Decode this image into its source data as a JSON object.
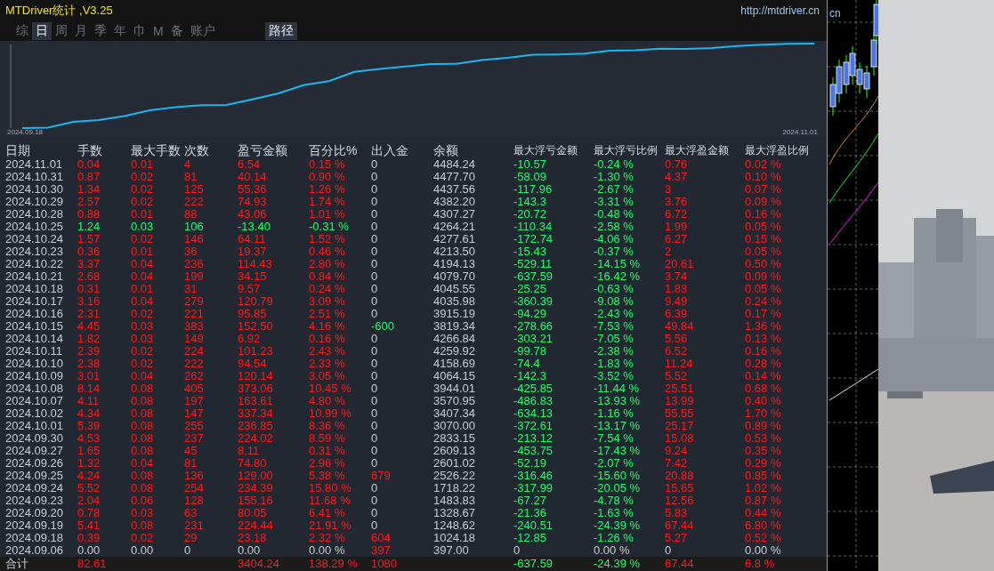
{
  "window": {
    "title": "MTDriver统计 ,V3.25",
    "url": "http://mtdriver.cn"
  },
  "tabs": [
    {
      "label": "综",
      "selected": false
    },
    {
      "label": "日",
      "selected": true
    },
    {
      "label": "周",
      "selected": false
    },
    {
      "label": "月",
      "selected": false
    },
    {
      "label": "季",
      "selected": false
    },
    {
      "label": "年",
      "selected": false
    },
    {
      "label": "巾",
      "selected": false
    },
    {
      "label": "M",
      "selected": false
    },
    {
      "label": "备",
      "selected": false
    },
    {
      "label": "账户",
      "selected": false
    }
  ],
  "path_button": "路径",
  "chart": {
    "start_label": "2024.09.18",
    "end_label": "2024.11.01"
  },
  "table": {
    "columns": [
      "日期",
      "手数",
      "最大手数",
      "次数",
      "盈亏金额",
      "百分比%",
      "出入金",
      "余额",
      "最大浮亏金额",
      "最大浮亏比例",
      "最大浮盈金额",
      "最大浮盈比例"
    ],
    "rows": [
      {
        "cells": [
          "2024.11.01",
          "0.04",
          "0.01",
          "4",
          "6.54",
          "0.15 %",
          "0",
          "4484.24",
          "-10.57",
          "-0.24 %",
          "0.76",
          "0.02 %"
        ],
        "kind": "profit",
        "deposit": false,
        "withdrawal": false
      },
      {
        "cells": [
          "2024.10.31",
          "0.87",
          "0.02",
          "81",
          "40.14",
          "0.90 %",
          "0",
          "4477.70",
          "-58.09",
          "-1.30 %",
          "4.37",
          "0.10 %"
        ],
        "kind": "profit",
        "deposit": false,
        "withdrawal": false
      },
      {
        "cells": [
          "2024.10.30",
          "1.34",
          "0.02",
          "125",
          "55.36",
          "1.26 %",
          "0",
          "4437.56",
          "-117.96",
          "-2.67 %",
          "3",
          "0.07 %"
        ],
        "kind": "profit",
        "deposit": false,
        "withdrawal": false
      },
      {
        "cells": [
          "2024.10.29",
          "2.57",
          "0.02",
          "222",
          "74.93",
          "1.74 %",
          "0",
          "4382.20",
          "-143.3",
          "-3.31 %",
          "3.76",
          "0.09 %"
        ],
        "kind": "profit",
        "deposit": false,
        "withdrawal": false
      },
      {
        "cells": [
          "2024.10.28",
          "0.88",
          "0.01",
          "88",
          "43.06",
          "1.01 %",
          "0",
          "4307.27",
          "-20.72",
          "-0.48 %",
          "6.72",
          "0.16 %"
        ],
        "kind": "profit",
        "deposit": false,
        "withdrawal": false
      },
      {
        "cells": [
          "2024.10.25",
          "1.24",
          "0.03",
          "106",
          "-13.40",
          "-0.31 %",
          "0",
          "4264.21",
          "-110.34",
          "-2.58 %",
          "1.99",
          "0.05 %"
        ],
        "kind": "loss",
        "deposit": false,
        "withdrawal": false
      },
      {
        "cells": [
          "2024.10.24",
          "1.57",
          "0.02",
          "146",
          "64.11",
          "1.52 %",
          "0",
          "4277.61",
          "-172.74",
          "-4.06 %",
          "6.27",
          "0.15 %"
        ],
        "kind": "profit",
        "deposit": false,
        "withdrawal": false
      },
      {
        "cells": [
          "2024.10.23",
          "0.36",
          "0.01",
          "36",
          "19.37",
          "0.46 %",
          "0",
          "4213.50",
          "-15.43",
          "-0.37 %",
          "2",
          "0.05 %"
        ],
        "kind": "profit",
        "deposit": false,
        "withdrawal": false
      },
      {
        "cells": [
          "2024.10.22",
          "3.37",
          "0.04",
          "236",
          "114.43",
          "2.80 %",
          "0",
          "4194.13",
          "-529.11",
          "-14.15 %",
          "20.61",
          "0.50 %"
        ],
        "kind": "profit",
        "deposit": false,
        "withdrawal": false
      },
      {
        "cells": [
          "2024.10.21",
          "2.68",
          "0.04",
          "199",
          "34.15",
          "0.84 %",
          "0",
          "4079.70",
          "-637.59",
          "-16.42 %",
          "3.74",
          "0.09 %"
        ],
        "kind": "profit",
        "deposit": false,
        "withdrawal": false
      },
      {
        "cells": [
          "2024.10.18",
          "0.31",
          "0.01",
          "31",
          "9.57",
          "0.24 %",
          "0",
          "4045.55",
          "-25.25",
          "-0.63 %",
          "1.83",
          "0.05 %"
        ],
        "kind": "profit",
        "deposit": false,
        "withdrawal": false
      },
      {
        "cells": [
          "2024.10.17",
          "3.16",
          "0.04",
          "279",
          "120.79",
          "3.09 %",
          "0",
          "4035.98",
          "-360.39",
          "-9.08 %",
          "9.49",
          "0.24 %"
        ],
        "kind": "profit",
        "deposit": false,
        "withdrawal": false
      },
      {
        "cells": [
          "2024.10.16",
          "2.31",
          "0.02",
          "221",
          "95.85",
          "2.51 %",
          "0",
          "3915.19",
          "-94.29",
          "-2.43 %",
          "6.39",
          "0.17 %"
        ],
        "kind": "profit",
        "deposit": false,
        "withdrawal": false
      },
      {
        "cells": [
          "2024.10.15",
          "4.45",
          "0.03",
          "383",
          "152.50",
          "4.16 %",
          "-600",
          "3819.34",
          "-278.66",
          "-7.53 %",
          "49.84",
          "1.36 %"
        ],
        "kind": "profit",
        "deposit": false,
        "withdrawal": true
      },
      {
        "cells": [
          "2024.10.14",
          "1.82",
          "0.03",
          "149",
          "6.92",
          "0.16 %",
          "0",
          "4266.84",
          "-303.21",
          "-7.05 %",
          "5.56",
          "0.13 %"
        ],
        "kind": "profit",
        "deposit": false,
        "withdrawal": false
      },
      {
        "cells": [
          "2024.10.11",
          "2.39",
          "0.02",
          "224",
          "101.23",
          "2.43 %",
          "0",
          "4259.92",
          "-99.78",
          "-2.38 %",
          "6.52",
          "0.16 %"
        ],
        "kind": "profit",
        "deposit": false,
        "withdrawal": false
      },
      {
        "cells": [
          "2024.10.10",
          "2.38",
          "0.02",
          "222",
          "94.54",
          "2.33 %",
          "0",
          "4158.69",
          "-74.4",
          "-1.83 %",
          "11.24",
          "0.28 %"
        ],
        "kind": "profit",
        "deposit": false,
        "withdrawal": false
      },
      {
        "cells": [
          "2024.10.09",
          "3.01",
          "0.04",
          "262",
          "120.14",
          "3.05 %",
          "0",
          "4064.15",
          "-142.3",
          "-3.52 %",
          "5.52",
          "0.14 %"
        ],
        "kind": "profit",
        "deposit": false,
        "withdrawal": false
      },
      {
        "cells": [
          "2024.10.08",
          "8.14",
          "0.08",
          "405",
          "373.06",
          "10.45 %",
          "0",
          "3944.01",
          "-425.85",
          "-11.44 %",
          "25.51",
          "0.68 %"
        ],
        "kind": "profit",
        "deposit": false,
        "withdrawal": false
      },
      {
        "cells": [
          "2024.10.07",
          "4.11",
          "0.08",
          "197",
          "163.61",
          "4.80 %",
          "0",
          "3570.95",
          "-486.83",
          "-13.93 %",
          "13.99",
          "0.40 %"
        ],
        "kind": "profit",
        "deposit": false,
        "withdrawal": false
      },
      {
        "cells": [
          "2024.10.02",
          "4.34",
          "0.08",
          "147",
          "337.34",
          "10.99 %",
          "0",
          "3407.34",
          "-634.13",
          "-1.16 %",
          "55.55",
          "1.70 %"
        ],
        "kind": "profit",
        "deposit": false,
        "withdrawal": false
      },
      {
        "cells": [
          "2024.10.01",
          "5.39",
          "0.08",
          "255",
          "236.85",
          "8.36 %",
          "0",
          "3070.00",
          "-372.61",
          "-13.17 %",
          "25.17",
          "0.89 %"
        ],
        "kind": "profit",
        "deposit": false,
        "withdrawal": false
      },
      {
        "cells": [
          "2024.09.30",
          "4.53",
          "0.08",
          "237",
          "224.02",
          "8.59 %",
          "0",
          "2833.15",
          "-213.12",
          "-7.54 %",
          "15.08",
          "0.53 %"
        ],
        "kind": "profit",
        "deposit": false,
        "withdrawal": false
      },
      {
        "cells": [
          "2024.09.27",
          "1.65",
          "0.08",
          "45",
          "8.11",
          "0.31 %",
          "0",
          "2609.13",
          "-453.75",
          "-17.43 %",
          "9.24",
          "0.35 %"
        ],
        "kind": "profit",
        "deposit": false,
        "withdrawal": false
      },
      {
        "cells": [
          "2024.09.26",
          "1.32",
          "0.04",
          "81",
          "74.80",
          "2.96 %",
          "0",
          "2601.02",
          "-52.19",
          "-2.07 %",
          "7.42",
          "0.29 %"
        ],
        "kind": "profit",
        "deposit": false,
        "withdrawal": false
      },
      {
        "cells": [
          "2024.09.25",
          "4.24",
          "0.08",
          "136",
          "129.00",
          "5.38 %",
          "679",
          "2526.22",
          "-316.46",
          "-15.60 %",
          "20.88",
          "0.85 %"
        ],
        "kind": "profit",
        "deposit": true,
        "withdrawal": false
      },
      {
        "cells": [
          "2024.09.24",
          "5.52",
          "0.08",
          "254",
          "234.39",
          "15.80 %",
          "0",
          "1718.22",
          "-317.99",
          "-20.05 %",
          "15.65",
          "1.02 %"
        ],
        "kind": "profit",
        "deposit": false,
        "withdrawal": false
      },
      {
        "cells": [
          "2024.09.23",
          "2.04",
          "0.06",
          "128",
          "155.16",
          "11.68 %",
          "0",
          "1483.83",
          "-67.27",
          "-4.78 %",
          "12.56",
          "0.87 %"
        ],
        "kind": "profit",
        "deposit": false,
        "withdrawal": false
      },
      {
        "cells": [
          "2024.09.20",
          "0.78",
          "0.03",
          "63",
          "80.05",
          "6.41 %",
          "0",
          "1328.67",
          "-21.36",
          "-1.63 %",
          "5.83",
          "0.44 %"
        ],
        "kind": "profit",
        "deposit": false,
        "withdrawal": false
      },
      {
        "cells": [
          "2024.09.19",
          "5.41",
          "0.08",
          "231",
          "224.44",
          "21.91 %",
          "0",
          "1248.62",
          "-240.51",
          "-24.39 %",
          "67.44",
          "6.80 %"
        ],
        "kind": "profit",
        "deposit": false,
        "withdrawal": false
      },
      {
        "cells": [
          "2024.09.18",
          "0.39",
          "0.02",
          "29",
          "23.18",
          "2.32 %",
          "604",
          "1024.18",
          "-12.85",
          "-1.26 %",
          "5.27",
          "0.52 %"
        ],
        "kind": "profit",
        "deposit": true,
        "withdrawal": false
      },
      {
        "cells": [
          "2024.09.06",
          "0.00",
          "0.00",
          "0",
          "0.00",
          "0.00 %",
          "397",
          "397.00",
          "0",
          "0.00 %",
          "0",
          "0.00 %"
        ],
        "kind": "flat",
        "deposit": true,
        "withdrawal": false
      }
    ],
    "total": {
      "label": "合计",
      "lots": "82.61",
      "pnl": "3404.24",
      "pct": "138.29 %",
      "flow": "1080",
      "max_dd": "-637.59",
      "max_dd_pct": "-24.39 %",
      "max_fp": "67.44",
      "max_fp_pct": "6.8 %"
    }
  },
  "background_chart": {
    "label": "cn"
  }
}
